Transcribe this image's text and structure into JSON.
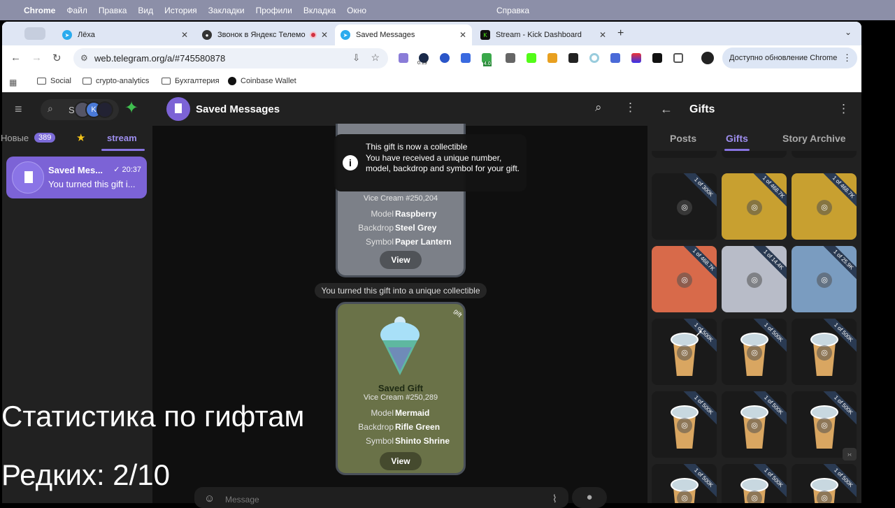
{
  "menubar": {
    "app": "Chrome",
    "items": [
      "Файл",
      "Правка",
      "Вид",
      "История",
      "Закладки",
      "Профили",
      "Вкладка",
      "Окно"
    ],
    "help": "Справка"
  },
  "tabs": [
    {
      "label": "Лёха",
      "fav_color": "#2AABEE"
    },
    {
      "label": "Звонок в Яндекс Телемо",
      "fav_color": "#333333"
    },
    {
      "label": "Saved Messages",
      "fav_color": "#2AABEE"
    },
    {
      "label": "Stream - Kick Dashboard",
      "fav_color": "#53FC18"
    }
  ],
  "omnibox": {
    "url": "web.telegram.org/a/#745580878"
  },
  "extensions": {
    "badge1": "0.19",
    "badge2": "4.0"
  },
  "update_button": "Доступно обновление Chrome",
  "bookmarks": [
    "Social",
    "crypto-analytics",
    "Бухгалтерия",
    "Coinbase Wallet"
  ],
  "left": {
    "search_hint": "S",
    "avatar_letter": "K",
    "filters": {
      "new_label": "Новые",
      "new_count": "389",
      "stream_label": "stream"
    },
    "chat": {
      "name": "Saved Mes...",
      "time": "✓ 20:37",
      "preview": "You turned this gift i..."
    }
  },
  "center": {
    "title": "Saved Messages",
    "toast": {
      "title": "This gift is now a collectible",
      "body": "You have received a unique number, model, backdrop and symbol for your gift."
    },
    "card1": {
      "number": "Vice Cream #250,204",
      "model_key": "Model",
      "model": "Raspberry",
      "backdrop_key": "Backdrop",
      "backdrop": "Steel Grey",
      "symbol_key": "Symbol",
      "symbol": "Paper Lantern",
      "view": "View"
    },
    "sysmsg": "You turned this gift into a unique collectible",
    "card2": {
      "ribbon": "gift",
      "title": "Saved Gift",
      "number": "Vice Cream #250,289",
      "model_key": "Model",
      "model": "Mermaid",
      "backdrop_key": "Backdrop",
      "backdrop": "Rifle Green",
      "symbol_key": "Symbol",
      "symbol": "Shinto Shrine",
      "view": "View"
    },
    "composer_placeholder": "Message"
  },
  "right": {
    "title": "Gifts",
    "tabs": [
      "Posts",
      "Gifts",
      "Story Archive"
    ],
    "row1": [
      {
        "ribbon": "1 of 300K",
        "bg": "#1a1a1a"
      },
      {
        "ribbon": "1 of 468.7K",
        "bg": "#c8a030"
      },
      {
        "ribbon": "1 of 468.7K",
        "bg": "#c8a030"
      }
    ],
    "row2": [
      {
        "ribbon": "1 of 468.7K",
        "bg": "#d86a4a"
      },
      {
        "ribbon": "1 of 14.4K",
        "bg": "#b8bcc8"
      },
      {
        "ribbon": "1 of 25.9K",
        "bg": "#7a9cc0"
      }
    ],
    "row3": [
      "1 of 500K",
      "1 of 500K",
      "1 of 500K"
    ],
    "row4": [
      "1 of 500K",
      "1 of 500K",
      "1 of 500K"
    ],
    "row5": [
      "1 of 500K",
      "1 of 500K",
      "1 of 500K"
    ]
  },
  "overlay": {
    "line1": "Статистика по гифтам",
    "line2": "Редких: 2/10"
  }
}
